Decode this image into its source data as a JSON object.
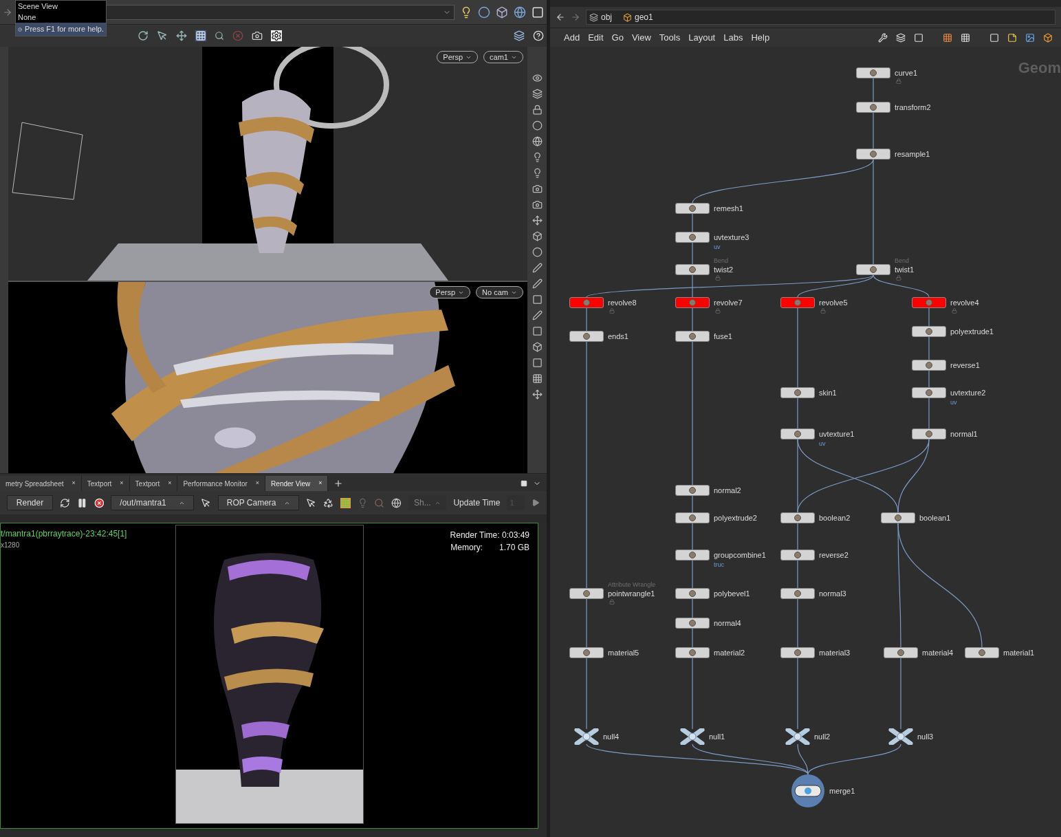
{
  "scene_view": {
    "tooltip": {
      "title": "Scene View",
      "value": "None",
      "help": "Press F1 for more help."
    },
    "viewports": [
      {
        "view_button": "Persp",
        "camera_button": "cam1"
      },
      {
        "view_button": "Persp",
        "camera_button": "No cam"
      }
    ]
  },
  "bottom_tabs": [
    {
      "label": "metry Spreadsheet",
      "close": "×",
      "selected": false
    },
    {
      "label": "Textport",
      "close": "×",
      "selected": false
    },
    {
      "label": "Textport",
      "close": "×",
      "selected": false
    },
    {
      "label": "Performance Monitor",
      "close": "×",
      "selected": false
    },
    {
      "label": "Render View",
      "close": "×",
      "selected": true
    }
  ],
  "render_toolbar": {
    "render_button": "Render",
    "rop_path": "/out/mantra1",
    "camera": "ROP Camera",
    "shading": "Sh...",
    "update_time_label": "Update Time",
    "update_time_value": "1"
  },
  "render_view": {
    "title": "t/mantra1(pbrraytrace)-23:42:45[1]",
    "resolution": "x1280",
    "render_time": "Render Time: 0:03:49",
    "memory_label": "Memory:",
    "memory_value": "1.70 GB"
  },
  "network": {
    "path": [
      "obj",
      "geo1"
    ],
    "menu": [
      "Add",
      "Edit",
      "Go",
      "View",
      "Tools",
      "Layout",
      "Labs",
      "Help"
    ],
    "context_label": "Geom",
    "nodes": [
      {
        "name": "curve1",
        "kind": "sop",
        "locked": true
      },
      {
        "name": "transform2",
        "kind": "sop",
        "locked": false
      },
      {
        "name": "resample1",
        "kind": "sop",
        "locked": false
      },
      {
        "name": "remesh1",
        "kind": "sop",
        "locked": false
      },
      {
        "name": "uvtexture3",
        "kind": "sop",
        "locked": false,
        "note": "uv"
      },
      {
        "name": "twist2",
        "kind": "sop",
        "locked": true,
        "type_label": "Bend"
      },
      {
        "name": "twist1",
        "kind": "sop",
        "locked": true,
        "type_label": "Bend"
      },
      {
        "name": "revolve8",
        "kind": "sop",
        "color": "#ff0000",
        "locked": true
      },
      {
        "name": "revolve7",
        "kind": "sop",
        "color": "#ff0000",
        "locked": true
      },
      {
        "name": "revolve5",
        "kind": "sop",
        "color": "#ff0000",
        "locked": true
      },
      {
        "name": "revolve4",
        "kind": "sop",
        "color": "#ff0000",
        "locked": true
      },
      {
        "name": "ends1",
        "kind": "sop",
        "locked": false
      },
      {
        "name": "fuse1",
        "kind": "sop",
        "locked": false
      },
      {
        "name": "polyextrude1",
        "kind": "sop",
        "locked": false
      },
      {
        "name": "reverse1",
        "kind": "sop",
        "locked": false
      },
      {
        "name": "skin1",
        "kind": "sop",
        "locked": false
      },
      {
        "name": "uvtexture2",
        "kind": "sop",
        "locked": false,
        "note": "uv"
      },
      {
        "name": "uvtexture1",
        "kind": "sop",
        "locked": false,
        "note": "uv"
      },
      {
        "name": "normal1",
        "kind": "sop",
        "locked": false
      },
      {
        "name": "normal2",
        "kind": "sop",
        "locked": false
      },
      {
        "name": "polyextrude2",
        "kind": "sop",
        "locked": false
      },
      {
        "name": "boolean2",
        "kind": "sop",
        "locked": false
      },
      {
        "name": "boolean1",
        "kind": "sop",
        "locked": false
      },
      {
        "name": "groupcombine1",
        "kind": "sop",
        "locked": false,
        "note": "truc"
      },
      {
        "name": "reverse2",
        "kind": "sop",
        "locked": false
      },
      {
        "name": "pointwrangle1",
        "kind": "sop",
        "locked": true,
        "type_label": "Attribute Wrangle"
      },
      {
        "name": "polybevel1",
        "kind": "sop",
        "locked": false
      },
      {
        "name": "normal3",
        "kind": "sop",
        "locked": false
      },
      {
        "name": "normal4",
        "kind": "sop",
        "locked": false
      },
      {
        "name": "material5",
        "kind": "sop",
        "locked": false
      },
      {
        "name": "material2",
        "kind": "sop",
        "locked": false
      },
      {
        "name": "material3",
        "kind": "sop",
        "locked": false
      },
      {
        "name": "material4",
        "kind": "sop",
        "locked": false
      },
      {
        "name": "material1",
        "kind": "sop",
        "locked": false
      },
      {
        "name": "null4",
        "kind": "null",
        "locked": false
      },
      {
        "name": "null1",
        "kind": "null",
        "locked": false
      },
      {
        "name": "null2",
        "kind": "null",
        "locked": false
      },
      {
        "name": "null3",
        "kind": "null",
        "locked": false
      },
      {
        "name": "merge1",
        "kind": "merge",
        "locked": false
      }
    ]
  }
}
